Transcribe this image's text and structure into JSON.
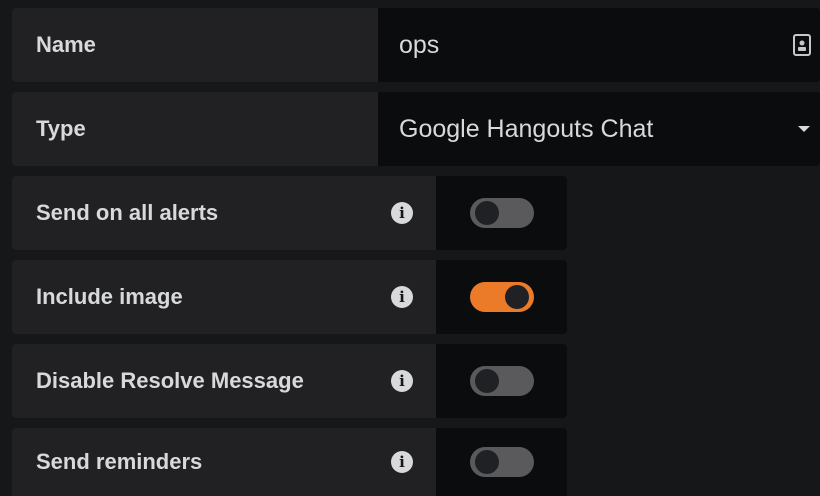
{
  "name_field": {
    "label": "Name",
    "value": "ops",
    "icon": "contact-card-icon"
  },
  "type_field": {
    "label": "Type",
    "selected": "Google Hangouts Chat",
    "icon": "caret-down-icon"
  },
  "switches": [
    {
      "label": "Send on all alerts",
      "on": false
    },
    {
      "label": "Include image",
      "on": true
    },
    {
      "label": "Disable Resolve Message",
      "on": false
    },
    {
      "label": "Send reminders",
      "on": false
    }
  ],
  "info_glyph": "i",
  "colors": {
    "background": "#161719",
    "label_bg": "#212124",
    "field_bg": "#0b0c0e",
    "toggle_on": "#eb7b28",
    "toggle_off": "#5a5a5c"
  }
}
